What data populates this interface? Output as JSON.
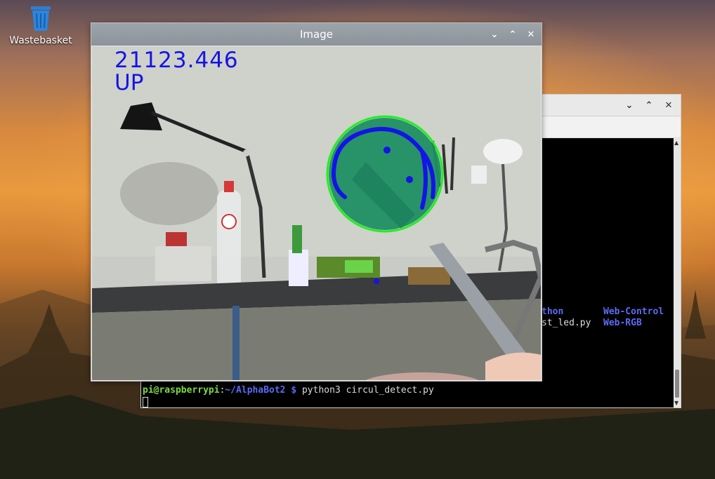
{
  "desktop": {
    "icons": [
      {
        "label": "Wastebasket",
        "icon": "trash-icon"
      }
    ]
  },
  "terminal": {
    "window_controls": [
      "minimize",
      "maximize",
      "close"
    ],
    "listing": [
      {
        "text": "thon",
        "color": "#5b6bf5"
      },
      {
        "text": "Web-Control",
        "color": "#5b6bf5"
      },
      {
        "text": "st_led.py",
        "color": "#dddddd"
      },
      {
        "text": "Web-RGB",
        "color": "#5b6bf5"
      }
    ],
    "prompt": {
      "user_host": "pi@raspberrypi",
      "colon": ":",
      "path": "~/AlphaBot2 $",
      "command": " python3 circul_detect.py"
    }
  },
  "image_window": {
    "title": "Image",
    "overlay_value": "21123.446",
    "overlay_direction": "UP",
    "colors": {
      "overlay_text": "#1414e6",
      "circle_outline": "#22ee22",
      "circle_fill": "#1f8f62"
    }
  }
}
